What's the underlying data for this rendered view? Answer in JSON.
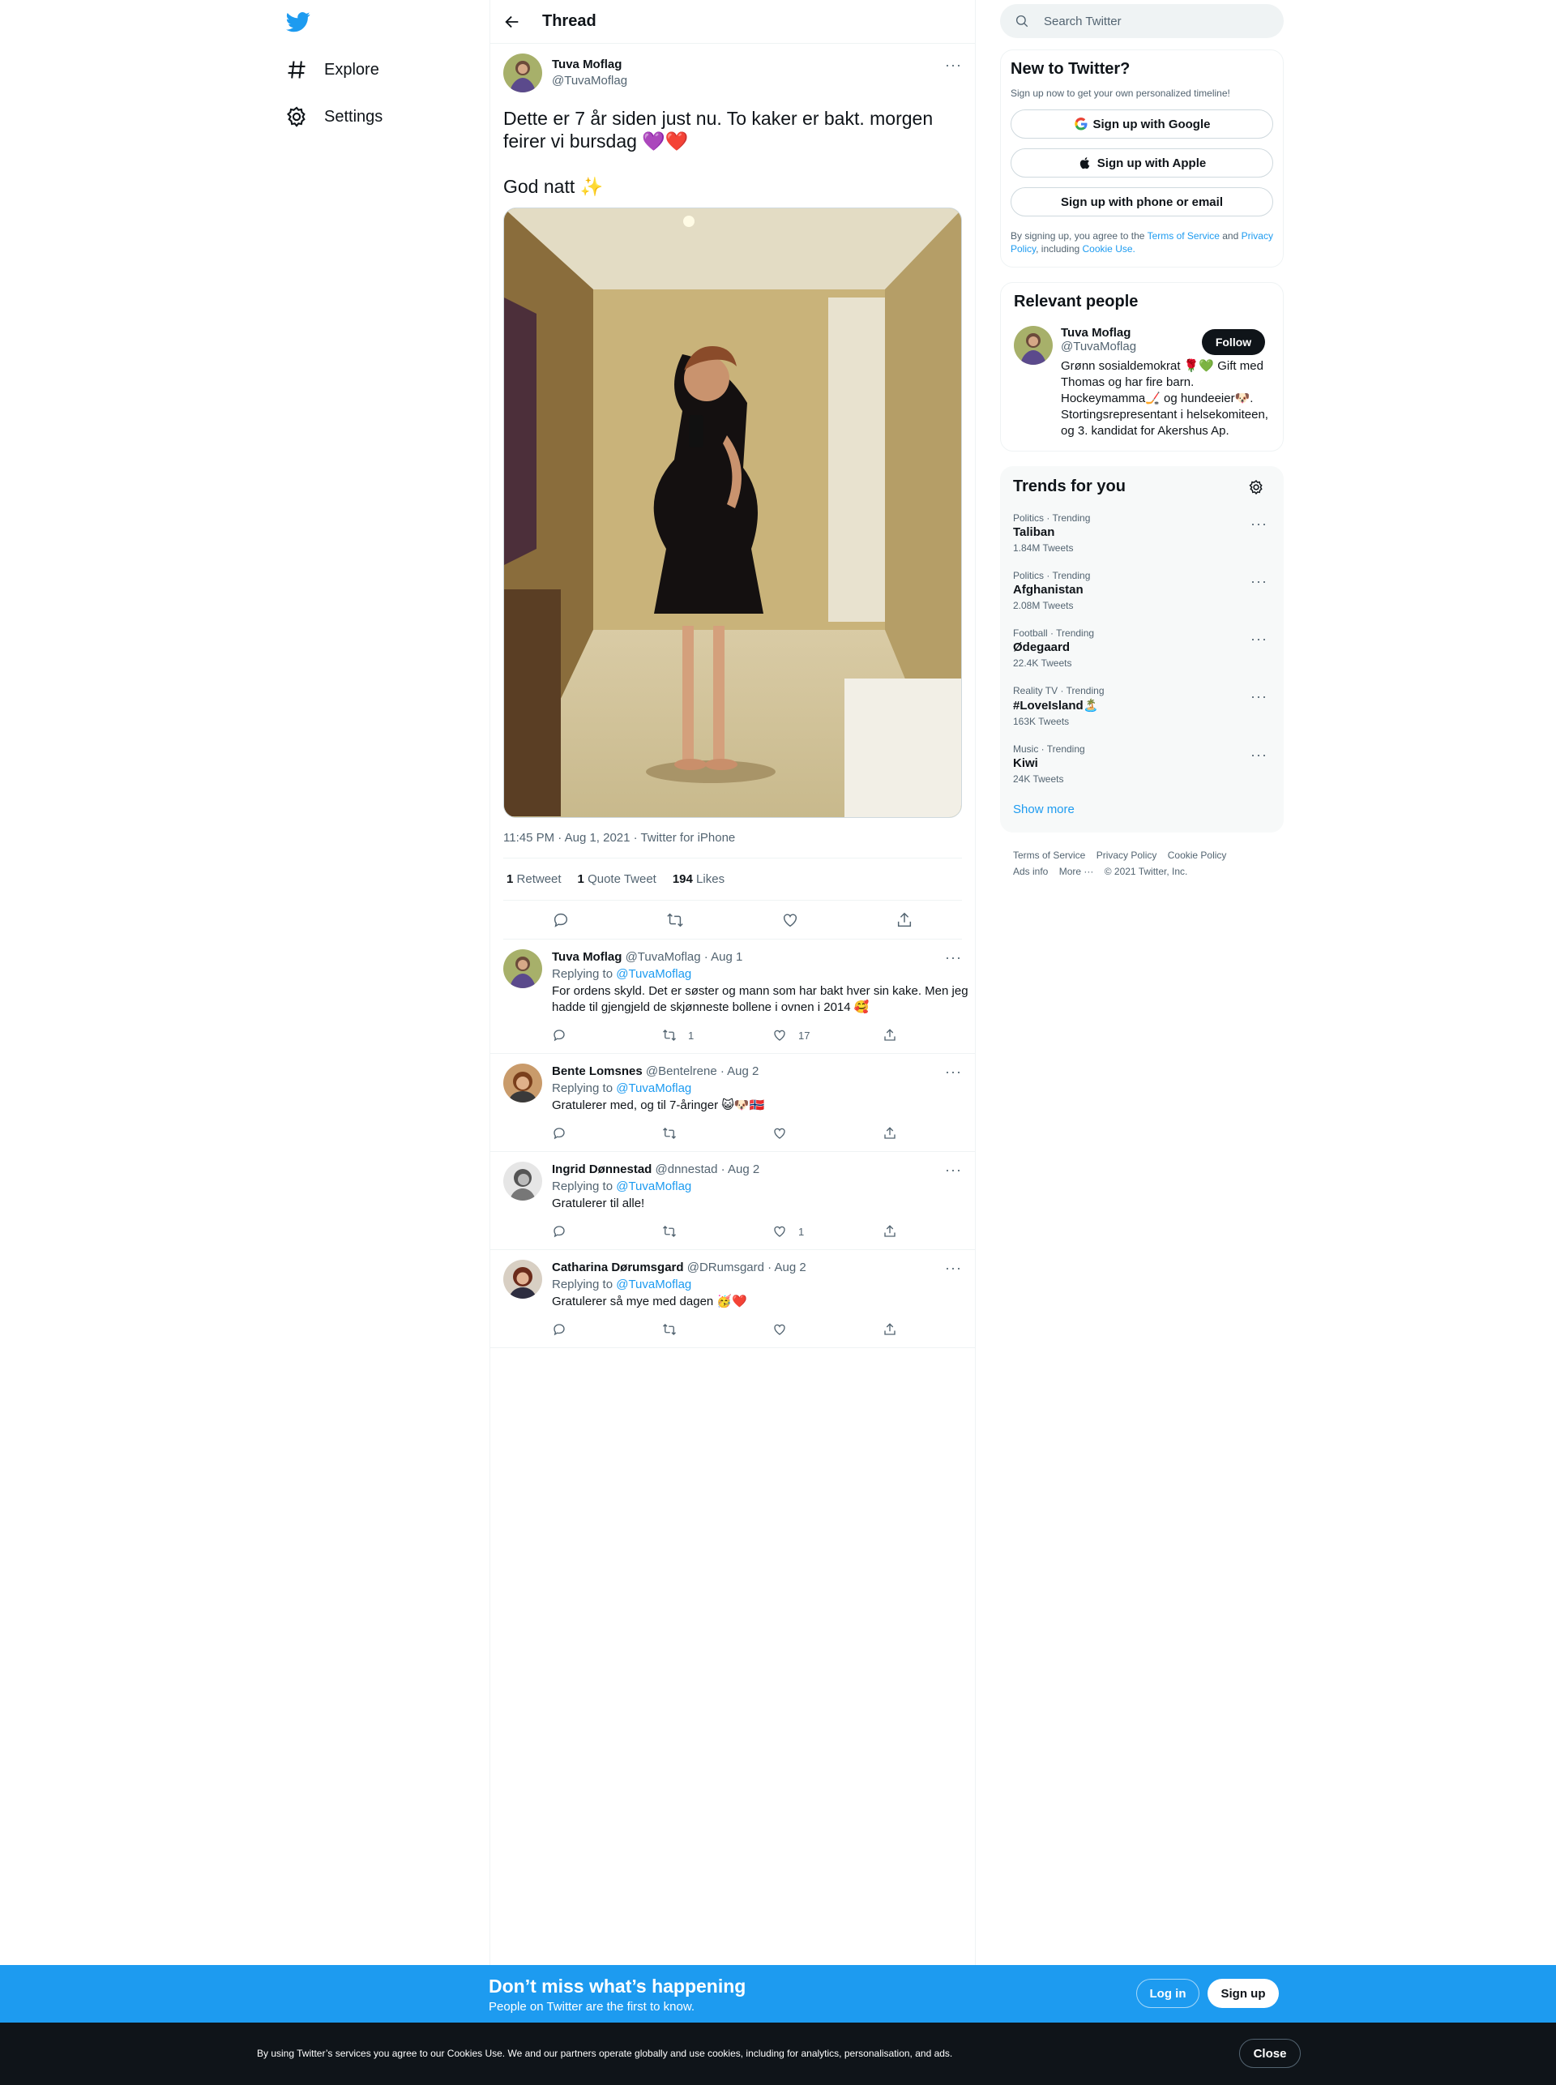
{
  "nav": {
    "explore": "Explore",
    "settings": "Settings"
  },
  "header": {
    "title": "Thread"
  },
  "main_tweet": {
    "name": "Tuva Moflag",
    "handle": "@TuvaMoflag",
    "text": "Dette er 7 år siden just nu. To kaker er bakt. morgen feirer vi bursdag 💜❤️\n\nGod natt ✨",
    "meta": "11:45 PM · Aug 1, 2021 · Twitter for iPhone",
    "retweets": "1",
    "retweets_label": "Retweet",
    "quotes": "1",
    "quotes_label": "Quote Tweet",
    "likes": "194",
    "likes_label": "Likes"
  },
  "replies": [
    {
      "name": "Tuva Moflag",
      "handle": "@TuvaMoflag",
      "date": "· Aug 1",
      "replying_label": "Replying to",
      "replying_to": "@TuvaMoflag",
      "text": "For ordens skyld. Det er søster og mann som har bakt hver sin kake. Men jeg hadde til gjengjeld de skjønneste bollene i ovnen i 2014 🥰",
      "retweets": "1",
      "likes": "17",
      "avatar_color": "#8a8f5a"
    },
    {
      "name": "Bente Lomsnes",
      "handle": "@Bentelrene",
      "date": "· Aug 2",
      "replying_label": "Replying to",
      "replying_to": "@TuvaMoflag",
      "text": "Gratulerer med, og til 7-åringer 😺🐶🇳🇴",
      "retweets": "",
      "likes": "",
      "avatar_color": "#9b5a2e"
    },
    {
      "name": "Ingrid Dønnestad",
      "handle": "@dnnestad",
      "date": "· Aug 2",
      "replying_label": "Replying to",
      "replying_to": "@TuvaMoflag",
      "text": "Gratulerer til alle!",
      "retweets": "",
      "likes": "1",
      "avatar_color": "#8d8d8d"
    },
    {
      "name": "Catharina Dørumsgard",
      "handle": "@DRumsgard",
      "date": "· Aug 2",
      "replying_label": "Replying to",
      "replying_to": "@TuvaMoflag",
      "text": "Gratulerer så mye med dagen 🥳❤️",
      "retweets": "",
      "likes": "",
      "avatar_color": "#6b3a2a"
    }
  ],
  "search": {
    "placeholder": "Search Twitter"
  },
  "signup": {
    "title": "New to Twitter?",
    "subtitle": "Sign up now to get your own personalized timeline!",
    "google": "Sign up with Google",
    "apple": "Sign up with Apple",
    "phone": "Sign up with phone or email",
    "terms_prefix": "By signing up, you agree to the ",
    "terms": "Terms of Service",
    "and": " and ",
    "privacy": "Privacy Policy",
    "including": ", including ",
    "cookie": "Cookie Use."
  },
  "relevant": {
    "title": "Relevant people",
    "name": "Tuva Moflag",
    "handle": "@TuvaMoflag",
    "follow": "Follow",
    "bio": "Grønn sosialdemokrat 🌹💚 Gift med Thomas og har fire barn. Hockeymamma🏒 og hundeeier🐶. Stortingsrepresentant i helsekomiteen, og 3. kandidat for Akershus Ap."
  },
  "trends": {
    "title": "Trends for you",
    "items": [
      {
        "category": "Politics · Trending",
        "name": "Taliban",
        "count": "1.84M Tweets"
      },
      {
        "category": "Politics · Trending",
        "name": "Afghanistan",
        "count": "2.08M Tweets"
      },
      {
        "category": "Football · Trending",
        "name": "Ødegaard",
        "count": "22.4K Tweets"
      },
      {
        "category": "Reality TV · Trending",
        "name": "#LoveIsland🏝️",
        "count": "163K Tweets"
      },
      {
        "category": "Music · Trending",
        "name": "Kiwi",
        "count": "24K Tweets"
      }
    ],
    "show_more": "Show more"
  },
  "footer": {
    "terms": "Terms of Service",
    "privacy": "Privacy Policy",
    "cookie": "Cookie Policy",
    "ads": "Ads info",
    "more": "More ···",
    "copyright": "© 2021 Twitter, Inc."
  },
  "banner": {
    "title": "Don’t miss what’s happening",
    "subtitle": "People on Twitter are the first to know.",
    "login": "Log in",
    "signup": "Sign up"
  },
  "cookie_bar": {
    "text": "By using Twitter’s services you agree to our Cookies Use. We and our partners operate globally and use cookies, including for analytics, personalisation, and ads.",
    "close": "Close"
  },
  "colors": {
    "brand": "#1d9bf0",
    "text": "#0f1419",
    "secondary": "#536471"
  }
}
